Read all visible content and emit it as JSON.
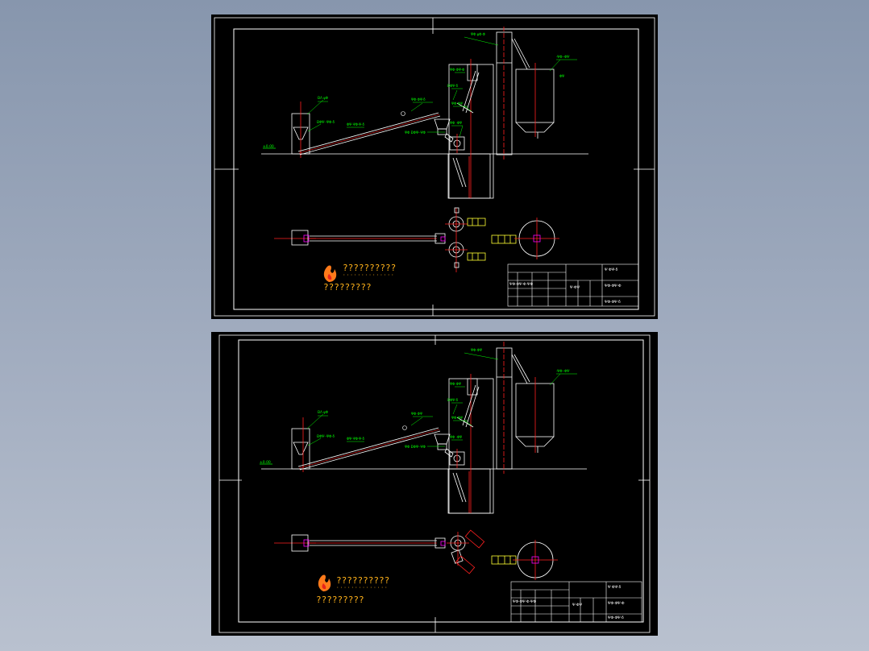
{
  "viewer": {
    "background_top": "#8796ad",
    "background_bottom": "#b9c1cf"
  },
  "colors": {
    "outline": "#ffffff",
    "centerline": "#ff2020",
    "leader": "#00ff00",
    "equipment_yellow": "#ffff33",
    "magenta": "#ff00ff",
    "logo": "#ffb21a"
  },
  "sheets": [
    {
      "id": "sheet-a",
      "logo_line1": "??????????",
      "logo_line2": "?????????",
      "logo_small": "··············"
    },
    {
      "id": "sheet-b",
      "logo_line1": "??????????",
      "logo_line2": "?????????",
      "logo_small": "··············"
    }
  ]
}
